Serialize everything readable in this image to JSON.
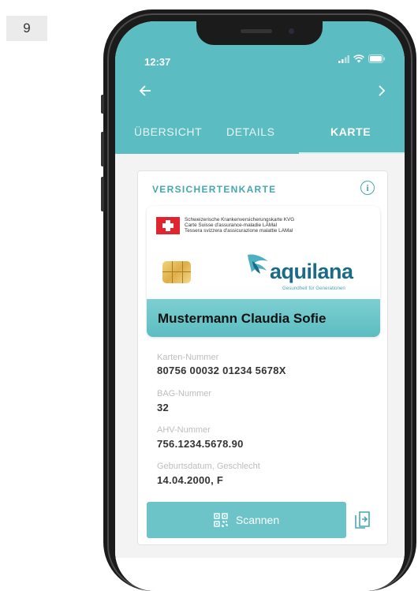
{
  "step_badge": "9",
  "status_bar": {
    "time": "12:37"
  },
  "tabs": [
    {
      "label": "ÜBERSICHT"
    },
    {
      "label": "DETAILS"
    },
    {
      "label": "KARTE"
    }
  ],
  "panel": {
    "title": "VERSICHERTENKARTE"
  },
  "card": {
    "lines": [
      "Schweizerische Krankenversicherungskarte KVG",
      "Carte Suisse d'assurance-maladie LAMal",
      "Tessera svizzera d'assicurazione malattie LAMal"
    ],
    "logo_text": "aquilana",
    "logo_tagline": "Gesundheit für Generationen",
    "holder_name": "Mustermann Claudia Sofie"
  },
  "fields": [
    {
      "label": "Karten-Nummer",
      "value": "80756 00032 01234 5678X"
    },
    {
      "label": "BAG-Nummer",
      "value": "32"
    },
    {
      "label": "AHV-Nummer",
      "value": "756.1234.5678.90"
    },
    {
      "label": "Geburtsdatum, Geschlecht",
      "value": "14.04.2000, F"
    }
  ],
  "scan_button": {
    "label": "Scannen"
  },
  "colors": {
    "accent": "#5bbdc1",
    "title": "#45a8ae",
    "button": "#6cc4c8"
  }
}
